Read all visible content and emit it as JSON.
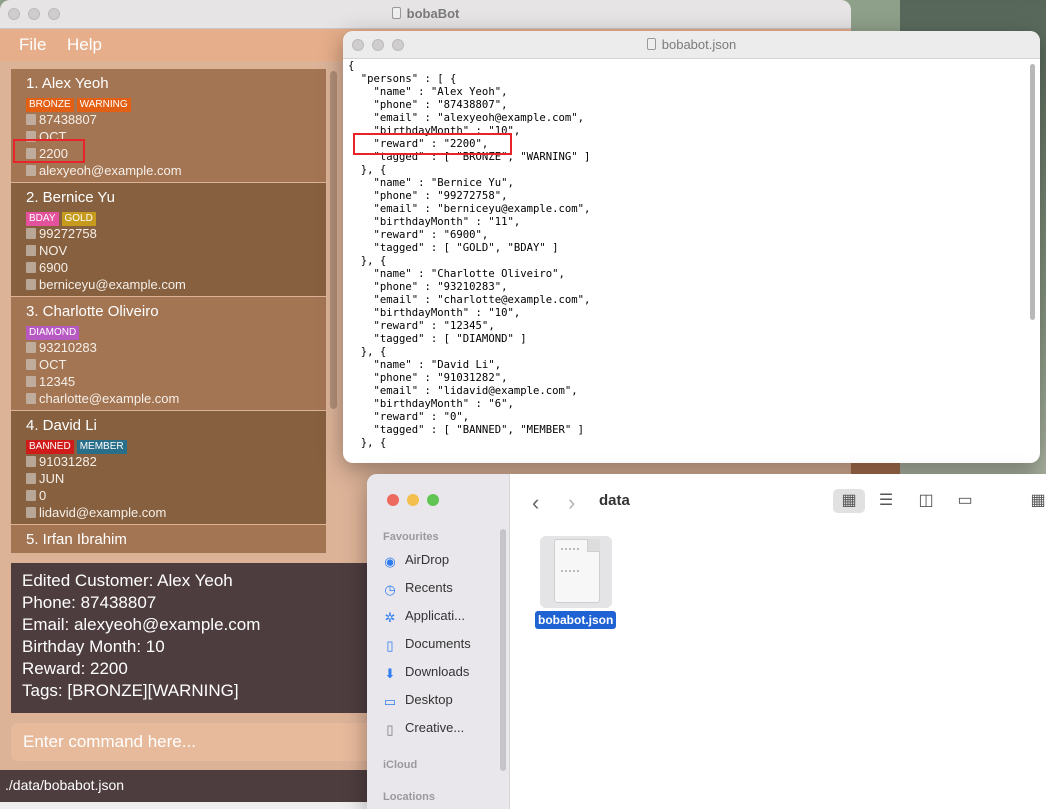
{
  "desktop": {},
  "bobabot": {
    "window_title": "bobaBot",
    "menu": [
      "File",
      "Help"
    ],
    "persons": [
      {
        "index": "1.",
        "name": "Alex Yeoh",
        "tags": [
          {
            "label": "BRONZE",
            "color": "#e35f14"
          },
          {
            "label": "WARNING",
            "color": "#e35f14"
          }
        ],
        "phone": "87438807",
        "month": "OCT",
        "reward": "2200",
        "email": "alexyeoh@example.com"
      },
      {
        "index": "2.",
        "name": "Bernice Yu",
        "tags": [
          {
            "label": "BDAY",
            "color": "#e4519c"
          },
          {
            "label": "GOLD",
            "color": "#c69a1c"
          }
        ],
        "phone": "99272758",
        "month": "NOV",
        "reward": "6900",
        "email": "berniceyu@example.com"
      },
      {
        "index": "3.",
        "name": "Charlotte Oliveiro",
        "tags": [
          {
            "label": "DIAMOND",
            "color": "#b759c2"
          }
        ],
        "phone": "93210283",
        "month": "OCT",
        "reward": "12345",
        "email": "charlotte@example.com"
      },
      {
        "index": "4.",
        "name": "David Li",
        "tags": [
          {
            "label": "BANNED",
            "color": "#d01b1b"
          },
          {
            "label": "MEMBER",
            "color": "#2a6f8a"
          }
        ],
        "phone": "91031282",
        "month": "JUN",
        "reward": "0",
        "email": "lidavid@example.com"
      },
      {
        "index": "5.",
        "name": "Irfan Ibrahim",
        "tags": [],
        "phone": "",
        "month": "",
        "reward": "",
        "email": ""
      }
    ],
    "result_lines": [
      "Edited Customer: Alex Yeoh",
      "Phone: 87438807",
      "Email: alexyeoh@example.com",
      "Birthday Month: 10",
      "Reward: 2200",
      "Tags: [BRONZE][WARNING]"
    ],
    "command_placeholder": "Enter command here...",
    "status_path": "./data/bobabot.json"
  },
  "json_viewer": {
    "window_title": "bobabot.json",
    "lines": [
      "{",
      "  \"persons\" : [ {",
      "    \"name\" : \"Alex Yeoh\",",
      "    \"phone\" : \"87438807\",",
      "    \"email\" : \"alexyeoh@example.com\",",
      "    \"birthdayMonth\" : \"10\",",
      "    \"reward\" : \"2200\",",
      "    \"tagged\" : [ \"BRONZE\", \"WARNING\" ]",
      "  }, {",
      "    \"name\" : \"Bernice Yu\",",
      "    \"phone\" : \"99272758\",",
      "    \"email\" : \"berniceyu@example.com\",",
      "    \"birthdayMonth\" : \"11\",",
      "    \"reward\" : \"6900\",",
      "    \"tagged\" : [ \"GOLD\", \"BDAY\" ]",
      "  }, {",
      "    \"name\" : \"Charlotte Oliveiro\",",
      "    \"phone\" : \"93210283\",",
      "    \"email\" : \"charlotte@example.com\",",
      "    \"birthdayMonth\" : \"10\",",
      "    \"reward\" : \"12345\",",
      "    \"tagged\" : [ \"DIAMOND\" ]",
      "  }, {",
      "    \"name\" : \"David Li\",",
      "    \"phone\" : \"91031282\",",
      "    \"email\" : \"lidavid@example.com\",",
      "    \"birthdayMonth\" : \"6\",",
      "    \"reward\" : \"0\",",
      "    \"tagged\" : [ \"BANNED\", \"MEMBER\" ]",
      "  }, {"
    ]
  },
  "finder": {
    "folder_title": "data",
    "sidebar_sections": {
      "favourites": "Favourites",
      "icloud": "iCloud",
      "locations": "Locations"
    },
    "sidebar_items": [
      {
        "label": "AirDrop",
        "icon": "airdrop-icon"
      },
      {
        "label": "Recents",
        "icon": "clock-icon"
      },
      {
        "label": "Applicati...",
        "icon": "applications-icon"
      },
      {
        "label": "Documents",
        "icon": "document-icon"
      },
      {
        "label": "Downloads",
        "icon": "download-icon"
      },
      {
        "label": "Desktop",
        "icon": "desktop-icon"
      },
      {
        "label": "Creative...",
        "icon": "file-icon"
      }
    ],
    "file_name": "bobabot.json"
  }
}
